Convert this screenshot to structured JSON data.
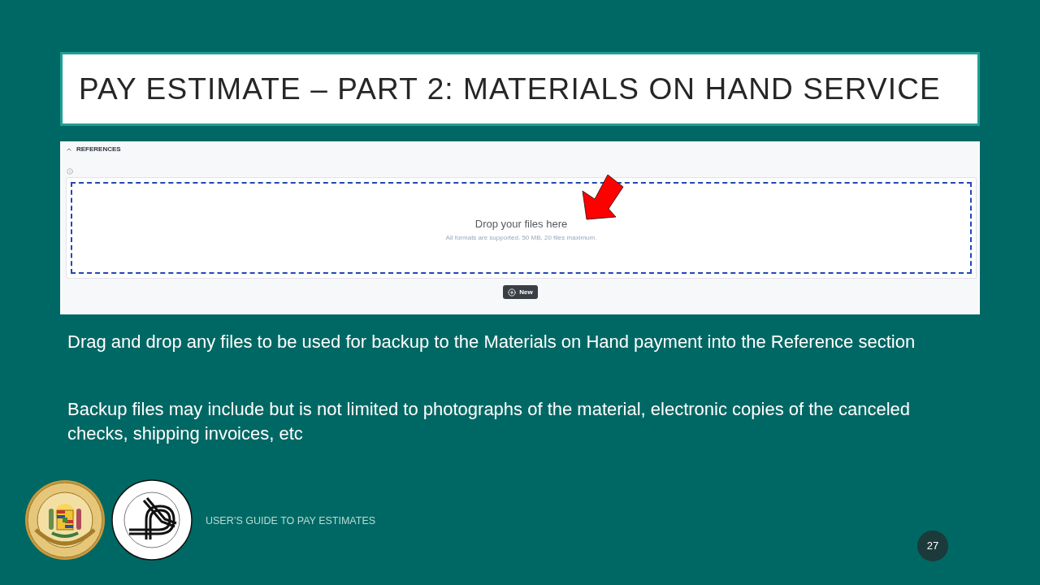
{
  "slide": {
    "title": "PAY ESTIMATE – PART 2: MATERIALS ON HAND SERVICE"
  },
  "app_screenshot": {
    "section": {
      "title": "REFERENCES",
      "expanded": true
    },
    "dropzone": {
      "title": "Drop your files here",
      "hint": "All formats are supported. 50 MB, 20 files maximum."
    },
    "new_button": {
      "label": "New"
    }
  },
  "paragraphs": [
    "Drag and drop any files to be used for backup to the Materials on Hand payment into the Reference section",
    "Backup files may include but is not limited to photographs of the material, electronic copies of the canceled checks, shipping invoices, etc"
  ],
  "footer": {
    "text": "USER’S GUIDE TO PAY ESTIMATES",
    "page_number": "27"
  }
}
